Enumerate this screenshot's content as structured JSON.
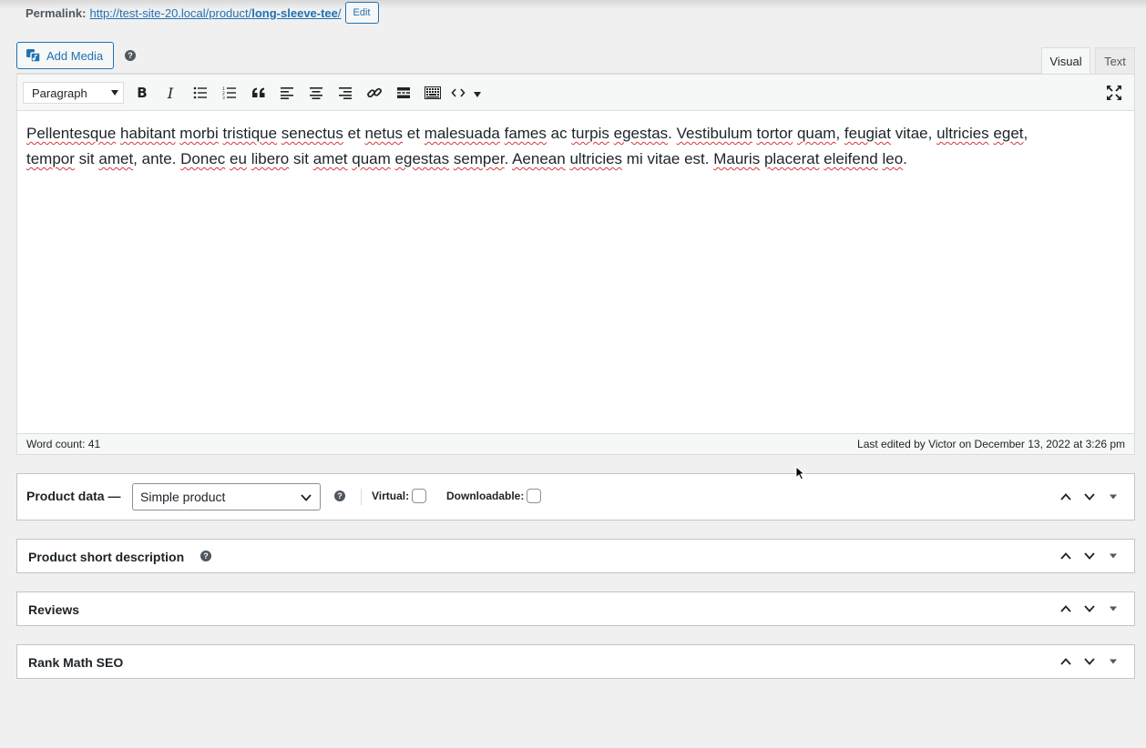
{
  "permalink": {
    "label": "Permalink:",
    "url_base": "http://test-site-20.local/product/",
    "slug": "long-sleeve-tee",
    "url_end": "/",
    "edit_label": "Edit"
  },
  "media": {
    "add_label": "Add Media",
    "help": "?"
  },
  "tabs": {
    "visual": "Visual",
    "text": "Text"
  },
  "toolbar": {
    "format_value": "Paragraph",
    "buttons": [
      "bold",
      "italic",
      "bulleted-list",
      "numbered-list",
      "blockquote",
      "align-left",
      "align-center",
      "align-right",
      "link",
      "read-more",
      "toolbar-toggle",
      "code",
      "fullscreen"
    ]
  },
  "editor": {
    "line1": [
      {
        "t": "Pellentesque",
        "s": true
      },
      {
        "t": " "
      },
      {
        "t": "habitant",
        "s": true
      },
      {
        "t": " "
      },
      {
        "t": "morbi",
        "s": true
      },
      {
        "t": " "
      },
      {
        "t": "tristique",
        "s": true
      },
      {
        "t": " "
      },
      {
        "t": "senectus",
        "s": true
      },
      {
        "t": " et "
      },
      {
        "t": "netus",
        "s": true
      },
      {
        "t": " et "
      },
      {
        "t": "malesuada",
        "s": true
      },
      {
        "t": " "
      },
      {
        "t": "fames",
        "s": true
      },
      {
        "t": " ac "
      },
      {
        "t": "turpis",
        "s": true
      },
      {
        "t": " "
      },
      {
        "t": "egestas",
        "s": true
      },
      {
        "t": ". "
      },
      {
        "t": "Vestibulum",
        "s": true
      },
      {
        "t": " "
      },
      {
        "t": "tortor",
        "s": true
      },
      {
        "t": " "
      },
      {
        "t": "quam",
        "s": true
      },
      {
        "t": ", "
      },
      {
        "t": "feugiat",
        "s": true
      },
      {
        "t": " vitae, "
      },
      {
        "t": "ultricies",
        "s": true
      },
      {
        "t": " "
      },
      {
        "t": "eget",
        "s": true
      },
      {
        "t": ","
      }
    ],
    "line2": [
      {
        "t": "tempor",
        "s": true
      },
      {
        "t": " sit "
      },
      {
        "t": "amet",
        "s": true
      },
      {
        "t": ", ante. "
      },
      {
        "t": "Donec",
        "s": true
      },
      {
        "t": " "
      },
      {
        "t": "eu",
        "s": true
      },
      {
        "t": " "
      },
      {
        "t": "libero",
        "s": true
      },
      {
        "t": " sit "
      },
      {
        "t": "amet",
        "s": true
      },
      {
        "t": " "
      },
      {
        "t": "quam",
        "s": true
      },
      {
        "t": " "
      },
      {
        "t": "egestas",
        "s": true
      },
      {
        "t": " "
      },
      {
        "t": "semper",
        "s": true
      },
      {
        "t": ". "
      },
      {
        "t": "Aenean",
        "s": true
      },
      {
        "t": " "
      },
      {
        "t": "ultricies",
        "s": true
      },
      {
        "t": " mi vitae est. "
      },
      {
        "t": "Mauris",
        "s": true
      },
      {
        "t": " "
      },
      {
        "t": "placerat",
        "s": true
      },
      {
        "t": " "
      },
      {
        "t": "eleifend",
        "s": true
      },
      {
        "t": " "
      },
      {
        "t": "leo",
        "s": true
      },
      {
        "t": "."
      }
    ],
    "word_count": "Word count: 41",
    "last_edited": "Last edited by Victor on December 13, 2022 at 3:26 pm"
  },
  "product_data": {
    "title": "Product data —",
    "type_value": "Simple product",
    "virtual_label": "Virtual:",
    "downloadable_label": "Downloadable:",
    "virtual_checked": false,
    "downloadable_checked": false
  },
  "metaboxes": {
    "short_description": "Product short description",
    "reviews": "Reviews",
    "rank_math": "Rank Math SEO"
  }
}
